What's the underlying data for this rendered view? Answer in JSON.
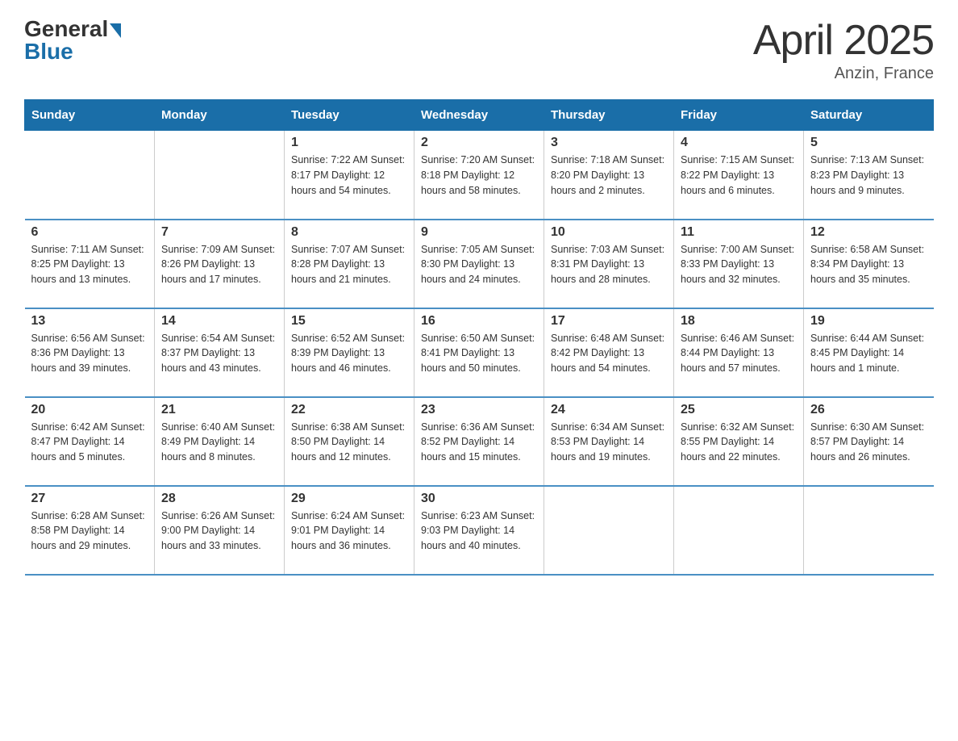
{
  "header": {
    "logo_general": "General",
    "logo_blue": "Blue",
    "title": "April 2025",
    "subtitle": "Anzin, France"
  },
  "days_of_week": [
    "Sunday",
    "Monday",
    "Tuesday",
    "Wednesday",
    "Thursday",
    "Friday",
    "Saturday"
  ],
  "weeks": [
    [
      {
        "day": "",
        "info": ""
      },
      {
        "day": "",
        "info": ""
      },
      {
        "day": "1",
        "info": "Sunrise: 7:22 AM\nSunset: 8:17 PM\nDaylight: 12 hours\nand 54 minutes."
      },
      {
        "day": "2",
        "info": "Sunrise: 7:20 AM\nSunset: 8:18 PM\nDaylight: 12 hours\nand 58 minutes."
      },
      {
        "day": "3",
        "info": "Sunrise: 7:18 AM\nSunset: 8:20 PM\nDaylight: 13 hours\nand 2 minutes."
      },
      {
        "day": "4",
        "info": "Sunrise: 7:15 AM\nSunset: 8:22 PM\nDaylight: 13 hours\nand 6 minutes."
      },
      {
        "day": "5",
        "info": "Sunrise: 7:13 AM\nSunset: 8:23 PM\nDaylight: 13 hours\nand 9 minutes."
      }
    ],
    [
      {
        "day": "6",
        "info": "Sunrise: 7:11 AM\nSunset: 8:25 PM\nDaylight: 13 hours\nand 13 minutes."
      },
      {
        "day": "7",
        "info": "Sunrise: 7:09 AM\nSunset: 8:26 PM\nDaylight: 13 hours\nand 17 minutes."
      },
      {
        "day": "8",
        "info": "Sunrise: 7:07 AM\nSunset: 8:28 PM\nDaylight: 13 hours\nand 21 minutes."
      },
      {
        "day": "9",
        "info": "Sunrise: 7:05 AM\nSunset: 8:30 PM\nDaylight: 13 hours\nand 24 minutes."
      },
      {
        "day": "10",
        "info": "Sunrise: 7:03 AM\nSunset: 8:31 PM\nDaylight: 13 hours\nand 28 minutes."
      },
      {
        "day": "11",
        "info": "Sunrise: 7:00 AM\nSunset: 8:33 PM\nDaylight: 13 hours\nand 32 minutes."
      },
      {
        "day": "12",
        "info": "Sunrise: 6:58 AM\nSunset: 8:34 PM\nDaylight: 13 hours\nand 35 minutes."
      }
    ],
    [
      {
        "day": "13",
        "info": "Sunrise: 6:56 AM\nSunset: 8:36 PM\nDaylight: 13 hours\nand 39 minutes."
      },
      {
        "day": "14",
        "info": "Sunrise: 6:54 AM\nSunset: 8:37 PM\nDaylight: 13 hours\nand 43 minutes."
      },
      {
        "day": "15",
        "info": "Sunrise: 6:52 AM\nSunset: 8:39 PM\nDaylight: 13 hours\nand 46 minutes."
      },
      {
        "day": "16",
        "info": "Sunrise: 6:50 AM\nSunset: 8:41 PM\nDaylight: 13 hours\nand 50 minutes."
      },
      {
        "day": "17",
        "info": "Sunrise: 6:48 AM\nSunset: 8:42 PM\nDaylight: 13 hours\nand 54 minutes."
      },
      {
        "day": "18",
        "info": "Sunrise: 6:46 AM\nSunset: 8:44 PM\nDaylight: 13 hours\nand 57 minutes."
      },
      {
        "day": "19",
        "info": "Sunrise: 6:44 AM\nSunset: 8:45 PM\nDaylight: 14 hours\nand 1 minute."
      }
    ],
    [
      {
        "day": "20",
        "info": "Sunrise: 6:42 AM\nSunset: 8:47 PM\nDaylight: 14 hours\nand 5 minutes."
      },
      {
        "day": "21",
        "info": "Sunrise: 6:40 AM\nSunset: 8:49 PM\nDaylight: 14 hours\nand 8 minutes."
      },
      {
        "day": "22",
        "info": "Sunrise: 6:38 AM\nSunset: 8:50 PM\nDaylight: 14 hours\nand 12 minutes."
      },
      {
        "day": "23",
        "info": "Sunrise: 6:36 AM\nSunset: 8:52 PM\nDaylight: 14 hours\nand 15 minutes."
      },
      {
        "day": "24",
        "info": "Sunrise: 6:34 AM\nSunset: 8:53 PM\nDaylight: 14 hours\nand 19 minutes."
      },
      {
        "day": "25",
        "info": "Sunrise: 6:32 AM\nSunset: 8:55 PM\nDaylight: 14 hours\nand 22 minutes."
      },
      {
        "day": "26",
        "info": "Sunrise: 6:30 AM\nSunset: 8:57 PM\nDaylight: 14 hours\nand 26 minutes."
      }
    ],
    [
      {
        "day": "27",
        "info": "Sunrise: 6:28 AM\nSunset: 8:58 PM\nDaylight: 14 hours\nand 29 minutes."
      },
      {
        "day": "28",
        "info": "Sunrise: 6:26 AM\nSunset: 9:00 PM\nDaylight: 14 hours\nand 33 minutes."
      },
      {
        "day": "29",
        "info": "Sunrise: 6:24 AM\nSunset: 9:01 PM\nDaylight: 14 hours\nand 36 minutes."
      },
      {
        "day": "30",
        "info": "Sunrise: 6:23 AM\nSunset: 9:03 PM\nDaylight: 14 hours\nand 40 minutes."
      },
      {
        "day": "",
        "info": ""
      },
      {
        "day": "",
        "info": ""
      },
      {
        "day": "",
        "info": ""
      }
    ]
  ]
}
